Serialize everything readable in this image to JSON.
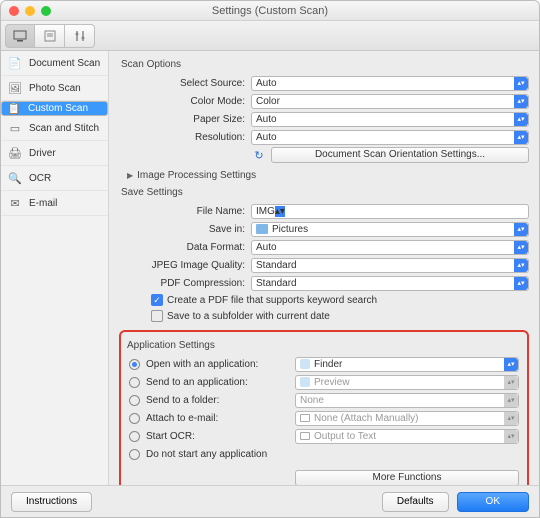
{
  "title": "Settings (Custom Scan)",
  "sidebar": {
    "items": [
      {
        "label": "Document Scan"
      },
      {
        "label": "Photo Scan"
      },
      {
        "label": "Custom Scan"
      },
      {
        "label": "Scan and Stitch"
      },
      {
        "label": "Driver"
      },
      {
        "label": "OCR"
      },
      {
        "label": "E-mail"
      }
    ]
  },
  "scan_options": {
    "heading": "Scan Options",
    "select_source_label": "Select Source:",
    "select_source": "Auto",
    "color_mode_label": "Color Mode:",
    "color_mode": "Color",
    "paper_size_label": "Paper Size:",
    "paper_size": "Auto",
    "resolution_label": "Resolution:",
    "resolution": "Auto",
    "orientation_btn": "Document Scan Orientation Settings...",
    "image_proc": "Image Processing Settings"
  },
  "save_settings": {
    "heading": "Save Settings",
    "file_name_label": "File Name:",
    "file_name": "IMG",
    "save_in_label": "Save in:",
    "save_in": "Pictures",
    "data_format_label": "Data Format:",
    "data_format": "Auto",
    "jpeg_label": "JPEG Image Quality:",
    "jpeg": "Standard",
    "pdf_label": "PDF Compression:",
    "pdf": "Standard",
    "chk_pdf_keyword": "Create a PDF file that supports keyword search",
    "chk_subfolder": "Save to a subfolder with current date"
  },
  "app_settings": {
    "heading": "Application Settings",
    "open_with_label": "Open with an application:",
    "open_with": "Finder",
    "send_app_label": "Send to an application:",
    "send_app": "Preview",
    "send_folder_label": "Send to a folder:",
    "send_folder": "None",
    "attach_label": "Attach to e-mail:",
    "attach": "None (Attach Manually)",
    "ocr_label": "Start OCR:",
    "ocr": "Output to Text",
    "none_label": "Do not start any application",
    "more_functions": "More Functions"
  },
  "footer": {
    "instructions": "Instructions",
    "defaults": "Defaults",
    "ok": "OK"
  }
}
